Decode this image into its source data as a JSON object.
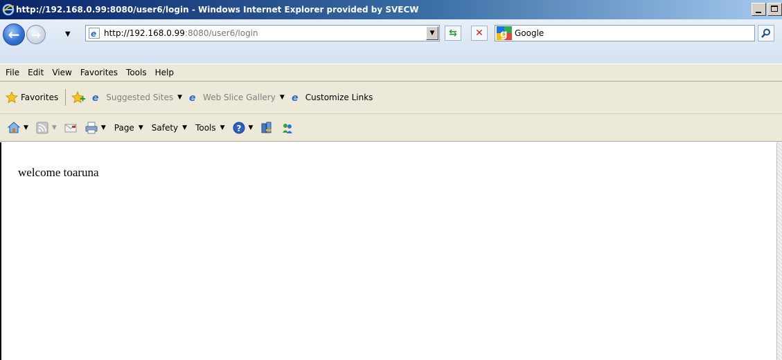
{
  "window": {
    "title": "http://192.168.0.99:8080/user6/login - Windows Internet Explorer provided by SVECW"
  },
  "address": {
    "url_host": "http://192.168.0.99",
    "url_rest": ":8080/user6/login"
  },
  "search": {
    "provider": "Google"
  },
  "menu": [
    "File",
    "Edit",
    "View",
    "Favorites",
    "Tools",
    "Help"
  ],
  "favorites_bar": {
    "favorites_label": "Favorites",
    "links": [
      {
        "label": "Suggested Sites",
        "has_dropdown": true
      },
      {
        "label": "Web Slice Gallery",
        "has_dropdown": true
      },
      {
        "label": "Customize Links",
        "has_dropdown": false
      }
    ]
  },
  "command_bar": {
    "page_label": "Page",
    "safety_label": "Safety",
    "tools_label": "Tools"
  },
  "page": {
    "body_text": "welcome toaruna"
  },
  "colors": {
    "titlebar_start": "#0a246a",
    "titlebar_end": "#a6caf0",
    "toolbar_bg": "#ece9d8"
  }
}
